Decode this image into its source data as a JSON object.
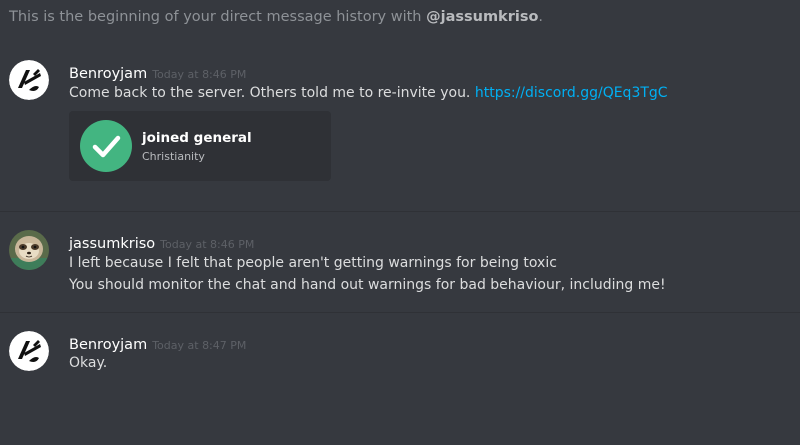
{
  "intro": {
    "prefix": "This is the beginning of your direct message history with ",
    "username": "@jassumkriso",
    "suffix": "."
  },
  "messages": [
    {
      "author": "Benroyjam",
      "timestamp": "Today at 8:46 PM",
      "text": "Come back to the server. Others told me to re-invite you. ",
      "link": "https://discord.gg/QEq3TgC",
      "avatar_icon": "benroyjam-logo-icon",
      "invite": {
        "title": "joined general",
        "subtitle": "Christianity",
        "icon": "checkmark-icon",
        "color": "#43b581"
      }
    },
    {
      "author": "jassumkriso",
      "timestamp": "Today at 8:46 PM",
      "lines": [
        "I left because I felt that people aren't getting warnings for being toxic",
        "You should monitor the chat and hand out warnings for bad behaviour, including me!"
      ],
      "avatar_icon": "sloth-avatar-icon"
    },
    {
      "author": "Benroyjam",
      "timestamp": "Today at 8:47 PM",
      "text": "Okay.",
      "avatar_icon": "benroyjam-logo-icon"
    }
  ],
  "colors": {
    "background": "#36393f",
    "card": "#2f3136",
    "link": "#00b0f4",
    "success": "#43b581"
  }
}
